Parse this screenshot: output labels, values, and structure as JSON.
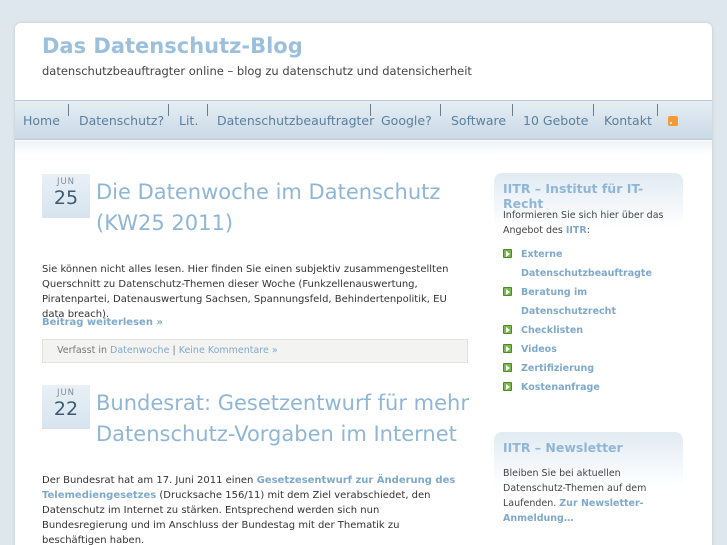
{
  "site": {
    "title": "Das Datenschutz-Blog",
    "description": "datenschutzbeauftragter online – blog zu datenschutz und datensicherheit"
  },
  "nav": {
    "items": [
      "Home",
      "Datenschutz?",
      "Lit.",
      "Datenschutzbeauftragter",
      "Google?",
      "Software",
      "10 Gebote",
      "Kontakt"
    ],
    "rss_icon": "rss-icon",
    "colors": {
      "link": "#5b7f9e",
      "accent": "#8fb6d6"
    }
  },
  "posts": [
    {
      "month": "JUN",
      "day": "25",
      "title": "Die Datenwoche im Datenschutz (KW25 2011)",
      "excerpt": "Sie können nicht alles lesen. Hier finden Sie einen subjektiv zusammengestellten Querschnitt zu Datenschutz-Themen dieser Woche (Funkzellenauswertung, Piratenpartei, Datenauswertung Sachsen, Spannungsfeld, Behindertenpolitik, EU data breach).",
      "readmore": "Beitrag weiterlesen »",
      "meta_prefix": "Verfasst in",
      "category": "Datenwoche",
      "separator": "|",
      "comments": "Keine Kommentare »"
    },
    {
      "month": "JUN",
      "day": "22",
      "title": "Bundesrat: Gesetzentwurf für mehr Datenschutz-Vorgaben im Internet",
      "excerpt_before": "Der Bundesrat hat am 17. Juni 2011 einen",
      "excerpt_link": "Gesetzesentwurf zur Änderung des Telemediengesetzes",
      "excerpt_after": "(Drucksache 156/11) mit dem Ziel verabschiedet, den Datenschutz im Internet zu stärken. Entsprechend werden sich nun Bundesregierung und im Anschluss der Bundestag mit der Thematik zu beschäftigen haben."
    }
  ],
  "sidebar": {
    "iitr": {
      "title": "IITR – Institut für IT-Recht",
      "text_before": "Informieren Sie sich hier über das Angebot des",
      "text_link": "IITR",
      "text_after": ":",
      "items": [
        "Externe Datenschutzbeauftragte",
        "Beratung im Datenschutzrecht",
        "Checklisten",
        "Videos",
        "Zertifizierung",
        "Kostenanfrage"
      ]
    },
    "newsletter": {
      "title": "IITR – Newsletter",
      "text_before": "Bleiben Sie bei aktuellen Datenschutz-Themen auf dem Laufenden.",
      "text_link": "Zur Newsletter-Anmeldung…"
    }
  }
}
